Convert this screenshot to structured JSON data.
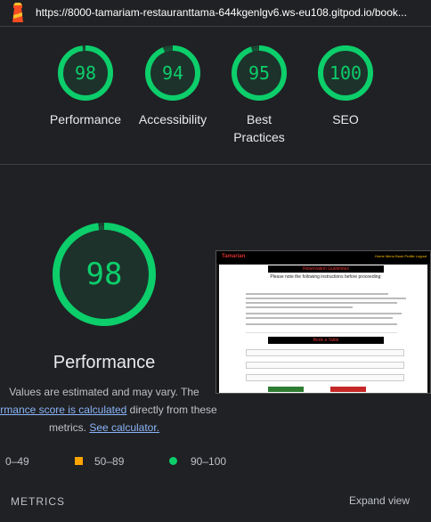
{
  "url": "https://8000-tamariam-restauranttama-644kgenlgv6.ws-eu108.gitpod.io/book...",
  "colors": {
    "pass": "#0cce6b",
    "average": "#ffa400",
    "fail": "#ff4e42",
    "link": "#8ab4f8",
    "background": "#202124"
  },
  "scores": [
    {
      "value": "98",
      "label": "Performance",
      "fraction": 0.98
    },
    {
      "value": "94",
      "label": "Accessibility",
      "fraction": 0.94
    },
    {
      "value": "95",
      "label": "Best\nPractices",
      "fraction": 0.95
    },
    {
      "value": "100",
      "label": "SEO",
      "fraction": 1.0
    }
  ],
  "main": {
    "score": "98",
    "fraction": 0.98,
    "label": "Performance",
    "note_1": "Values are estimated and may vary. The",
    "note_link_1": "formance score is calculated",
    "note_2": " directly from these",
    "note_3": "metrics. ",
    "note_link_2": "See calculator."
  },
  "legend": {
    "fail": "0–49",
    "average": "50–89",
    "pass": "90–100"
  },
  "metrics": {
    "title": "METRICS",
    "expand": "Expand view"
  },
  "preview": {
    "brand": "Tamarian",
    "nav": "Home  Menu  Book  Profile  Logout",
    "heading": "Reservation Guidelines",
    "subheading": "Please note the following instructions before proceeding:",
    "form_title": "Book a Table"
  }
}
